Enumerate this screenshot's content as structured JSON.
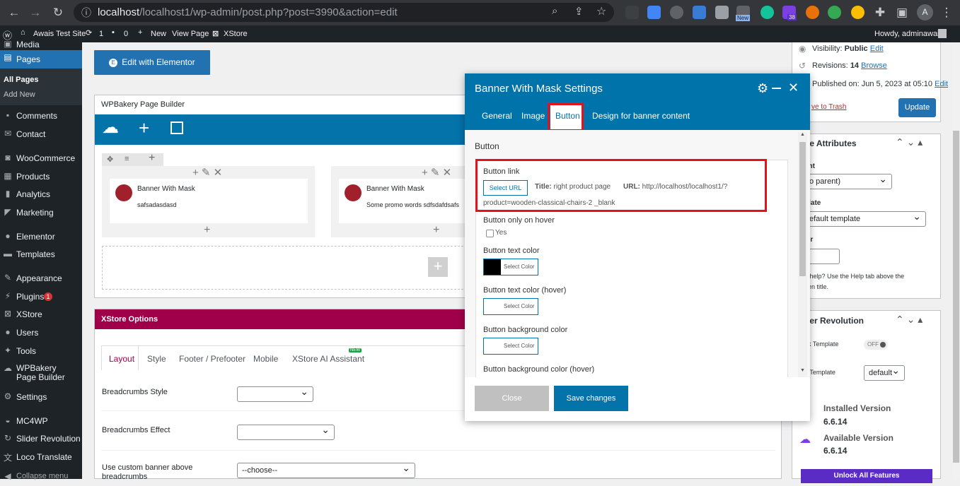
{
  "browser": {
    "url_host": "localhost",
    "url_rest": "/localhost1/wp-admin/post.php?post=3990&action=edit",
    "ext_new_badge": "New",
    "ext_count_badge": "38",
    "profile_initial": "A"
  },
  "adminbar": {
    "site": "Awais Test Site",
    "updates": "1",
    "comments": "0",
    "new": "New",
    "view_page": "View Page",
    "xstore": "XStore",
    "howdy": "Howdy, adminawais"
  },
  "sidebar": {
    "items": [
      {
        "label": "Media",
        "icon": "media-icon"
      },
      {
        "label": "Pages",
        "icon": "pages-icon"
      },
      {
        "label": "All Pages"
      },
      {
        "label": "Add New"
      },
      {
        "label": "Comments",
        "icon": "comments-icon"
      },
      {
        "label": "Contact",
        "icon": "mail-icon"
      },
      {
        "label": "WooCommerce",
        "icon": "woo-icon"
      },
      {
        "label": "Products",
        "icon": "products-icon"
      },
      {
        "label": "Analytics",
        "icon": "analytics-icon"
      },
      {
        "label": "Marketing",
        "icon": "megaphone-icon"
      },
      {
        "label": "Elementor",
        "icon": "elementor-icon"
      },
      {
        "label": "Templates",
        "icon": "folder-icon"
      },
      {
        "label": "Appearance",
        "icon": "brush-icon"
      },
      {
        "label": "Plugins",
        "icon": "plugin-icon",
        "badge": "1"
      },
      {
        "label": "XStore",
        "icon": "x-icon"
      },
      {
        "label": "Users",
        "icon": "users-icon"
      },
      {
        "label": "Tools",
        "icon": "wrench-icon"
      },
      {
        "label": "WPBakery Page Builder",
        "icon": "wpbakery-icon"
      },
      {
        "label": "Settings",
        "icon": "settings-icon"
      },
      {
        "label": "MC4WP",
        "icon": "mc4wp-icon"
      },
      {
        "label": "Slider Revolution",
        "icon": "revslider-icon"
      },
      {
        "label": "Loco Translate",
        "icon": "translate-icon"
      },
      {
        "label": "Collapse menu",
        "icon": "collapse-icon"
      }
    ]
  },
  "main": {
    "edit_elementor": "Edit with Elementor",
    "wpb_title": "WPBakery Page Builder",
    "element1_title": "Banner With Mask",
    "element1_text": "safsadasdasd",
    "element2_title": "Banner With Mask",
    "element2_text": "Some promo words sdfsdafdsafs",
    "xstore_title": "XStore Options",
    "tabs": [
      "Layout",
      "Style",
      "Footer / Prefooter",
      "Mobile",
      "XStore AI Assistant"
    ],
    "tab_new_badge": "NEW",
    "breadcrumbs_style_label": "Breadcrumbs Style",
    "breadcrumbs_effect_label": "Breadcrumbs Effect",
    "custom_banner_label": "Use custom banner above breadcrumbs",
    "custom_banner_value": "--choose--"
  },
  "modal": {
    "title": "Banner With Mask Settings",
    "tabs": [
      "General",
      "Image",
      "Button",
      "Design for banner content"
    ],
    "section_title": "Button",
    "button_link_label": "Button link",
    "select_url": "Select URL",
    "link_title_key": "Title:",
    "link_title_value": "right product page",
    "link_url_key": "URL:",
    "link_url_value": "http://localhost/localhost1/?",
    "link_url_value2": "product=wooden-classical-chairs-2 _blank",
    "hover_label": "Button only on hover",
    "hover_yes": "Yes",
    "text_color_label": "Button text color",
    "text_color_hover_label": "Button text color (hover)",
    "bg_color_label": "Button background color",
    "bg_color_hover_label": "Button background color (hover)",
    "select_color": "Select Color",
    "text_color_value": "#000000",
    "close": "Close",
    "save": "Save changes"
  },
  "right": {
    "visibility_label": "Visibility:",
    "visibility_value": "Public",
    "edit": "Edit",
    "revisions_label": "Revisions:",
    "revisions_value": "14",
    "browse": "Browse",
    "published": "Published on:",
    "published_date": "Jun 5, 2023 at 05:10",
    "trash": "ve to Trash",
    "update": "Update",
    "page_attr_title": "ge Attributes",
    "parent_label": "ent",
    "parent_value": "o parent)",
    "template_label": "plate",
    "template_value": "efault template",
    "order_label": "ler",
    "help_text1": "d help? Use the Help tab above the",
    "help_text2": "een title.",
    "slider_title": "der Revolution",
    "blank_template": "nk Template",
    "toggle_off": "OFF",
    "slide_template": "e Template",
    "default": "default",
    "installed_label": "Installed Version",
    "installed_value": "6.6.14",
    "available_label": "Available Version",
    "available_value": "6.6.14",
    "unlock": "Unlock All Features"
  },
  "colors": {
    "wp_blue": "#2271b1",
    "modal_blue": "#0073aa",
    "xstore_bar": "#a0004a",
    "highlight_red": "#e3121b",
    "unlock_purple": "#5b2bc6"
  }
}
